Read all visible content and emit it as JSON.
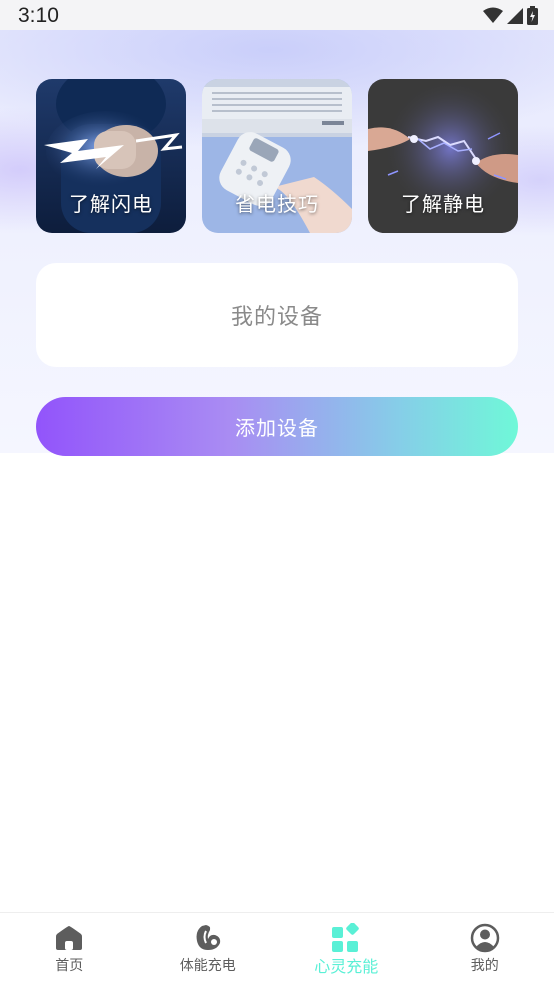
{
  "status_bar": {
    "time": "3:10"
  },
  "tips": [
    {
      "label": "了解闪电",
      "icon": "lightning-fist-image"
    },
    {
      "label": "省电技巧",
      "icon": "remote-control-image"
    },
    {
      "label": "了解静电",
      "icon": "static-spark-image"
    }
  ],
  "device_section": {
    "title": "我的设备"
  },
  "add_device": {
    "label": "添加设备"
  },
  "tabs": [
    {
      "label": "首页",
      "icon": "home-icon"
    },
    {
      "label": "体能充电",
      "icon": "fitness-icon"
    },
    {
      "label": "心灵充能",
      "icon": "grid-diamond-icon",
      "active": true
    },
    {
      "label": "我的",
      "icon": "profile-icon"
    }
  ],
  "colors": {
    "accent": "#5af0d6",
    "button_gradient_start": "#9254fb",
    "button_gradient_end": "#6ff8d8",
    "tab_inactive": "#5d5d5d"
  }
}
